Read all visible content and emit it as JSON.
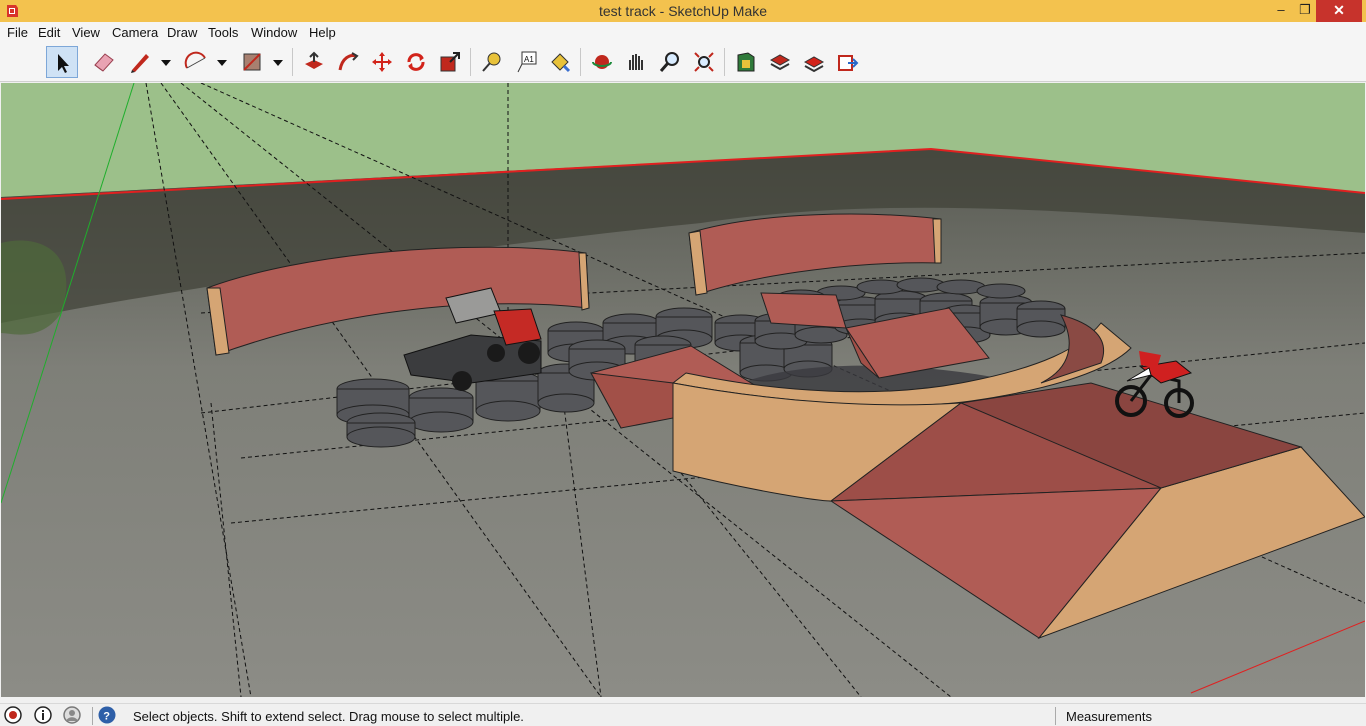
{
  "window": {
    "title": "test track - SketchUp Make",
    "minimize_glyph": "–",
    "maximize_glyph": "❐",
    "close_glyph": "✕"
  },
  "menu": [
    "File",
    "Edit",
    "View",
    "Camera",
    "Draw",
    "Tools",
    "Window",
    "Help"
  ],
  "toolbar": {
    "tools": [
      "select-icon",
      "eraser-icon",
      "pencil-line-icon",
      "arc-icon",
      "rectangle-icon",
      "push-pull-icon",
      "follow-me-icon",
      "move-icon",
      "rotate-icon",
      "scale-icon",
      "tape-measure-icon",
      "text-icon",
      "paint-bucket-icon",
      "orbit-icon",
      "pan-icon",
      "zoom-icon",
      "zoom-extents-icon",
      "3d-warehouse-icon",
      "extension-warehouse-icon",
      "components-icon",
      "send-to-layout-icon"
    ],
    "active_tool": "select-icon"
  },
  "status": {
    "message": "Select objects. Shift to extend select. Drag mouse to select multiple.",
    "measurements_label": "Measurements"
  },
  "colors": {
    "title_bar": "#f3c24e",
    "sky": "#9cc08a",
    "ground": "#7a7a72",
    "ramp_face": "#b05c55",
    "ramp_side": "#d5a574",
    "tires": "#55565a",
    "red_axis": "#e02020",
    "green_axis": "#1fae2c"
  }
}
